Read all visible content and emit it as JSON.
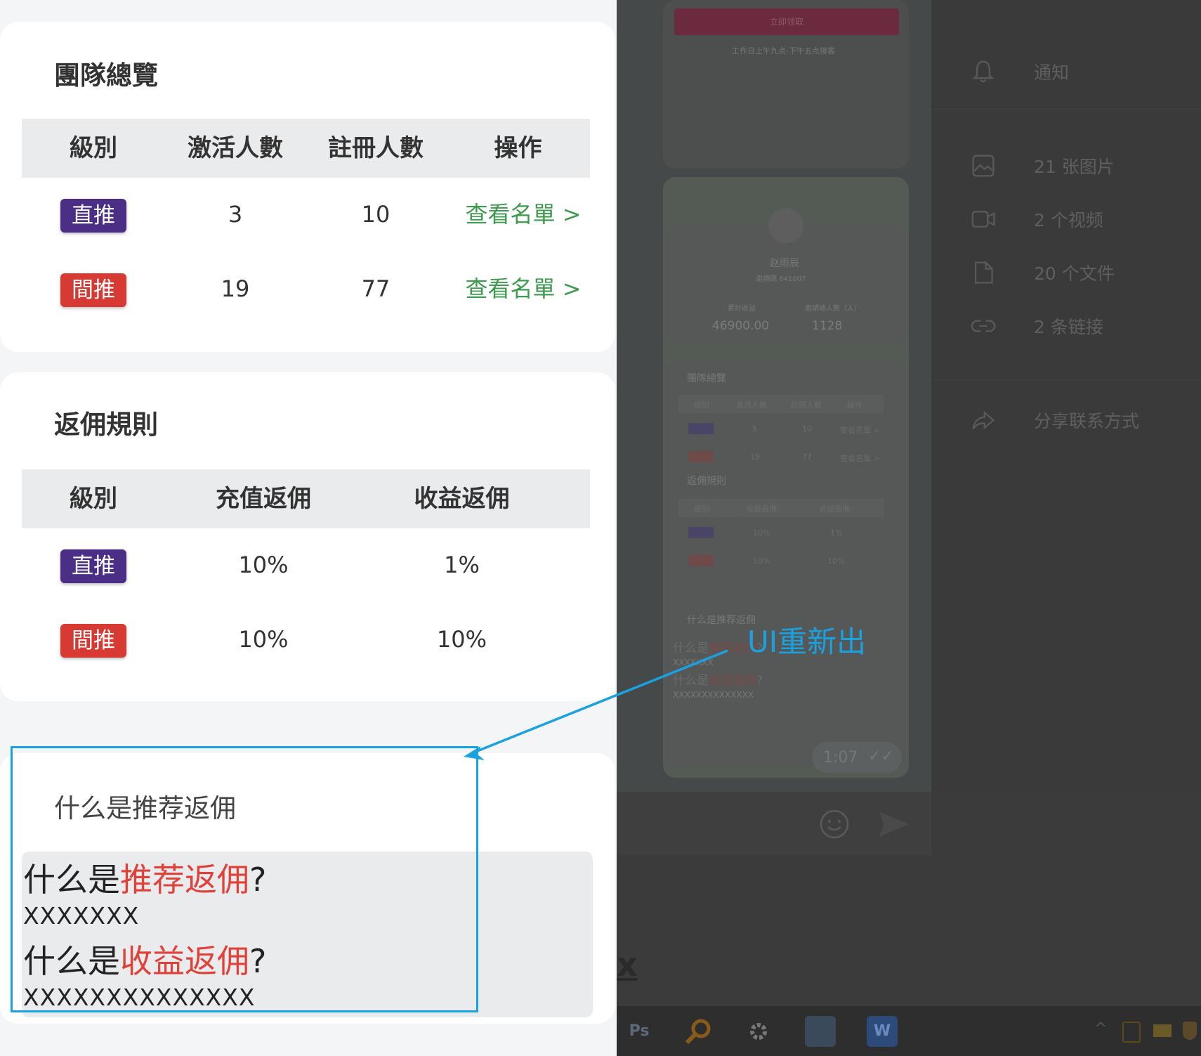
{
  "team_overview": {
    "title": "團隊總覽",
    "headers": [
      "級別",
      "激活人數",
      "註冊人數",
      "操作"
    ],
    "rows": [
      {
        "level": "直推",
        "active": "3",
        "registered": "10",
        "action": "查看名單 >"
      },
      {
        "level": "間推",
        "active": "19",
        "registered": "77",
        "action": "查看名單 >"
      }
    ]
  },
  "commission_rules": {
    "title": "返佣規則",
    "headers": [
      "級別",
      "充值返佣",
      "收益返佣"
    ],
    "rows": [
      {
        "level": "直推",
        "recharge": "10%",
        "earnings": "1%"
      },
      {
        "level": "間推",
        "recharge": "10%",
        "earnings": "10%"
      }
    ]
  },
  "faq": {
    "title": "什么是推荐返佣",
    "q1_prefix": "什么是",
    "q1_highlight": "推荐返佣",
    "q1_suffix": "?",
    "a1": "XXXXXXX",
    "q2_prefix": "什么是",
    "q2_highlight": "收益返佣",
    "q2_suffix": "?",
    "a2": "XXXXXXXXXXXXXX"
  },
  "annotation": {
    "text": "UI重新出",
    "color": "#1aa1e0"
  },
  "chat_preview": {
    "button_label": "立即领取",
    "hours_text": "工作日上午九点-下午五点接客",
    "name": "赵雨辰",
    "id_text": "邀請碼 641007",
    "stat_labels": [
      "累計收益",
      "邀請總人數（人）"
    ],
    "balance": "46900.00",
    "count": "1128",
    "team_title": "團隊總覽",
    "team_headers": [
      "級別",
      "激活人數",
      "註冊人數",
      "操作"
    ],
    "team_rows": [
      {
        "active": "3",
        "registered": "10",
        "action": "查看名單 >"
      },
      {
        "active": "19",
        "registered": "77",
        "action": "查看名單 >"
      }
    ],
    "rules_title": "返佣規則",
    "rules_headers": [
      "級別",
      "充值返佣",
      "收益返佣"
    ],
    "rules_rows": [
      {
        "recharge": "10%",
        "earnings": "1%"
      },
      {
        "recharge": "10%",
        "earnings": "10%"
      }
    ],
    "faq_title": "什么是推荐返佣",
    "q1_prefix": "什么是",
    "q1_highlight": "推荐返佣",
    "a1": "XXXXXXX",
    "q2_prefix": "什么是",
    "q2_highlight": "收益返佣",
    "a2": "XXXXXXXXXXXXXX",
    "timestamp": "1:07"
  },
  "side_panel": {
    "items": [
      {
        "icon": "bell-icon",
        "label": "通知"
      },
      {
        "icon": "image-icon",
        "label": "21 张图片"
      },
      {
        "icon": "video-icon",
        "label": "2 个视频"
      },
      {
        "icon": "file-icon",
        "label": "20 个文件"
      },
      {
        "icon": "link-icon",
        "label": "2 条链接"
      },
      {
        "icon": "share-icon",
        "label": "分享联系方式"
      }
    ]
  },
  "taskbar": {
    "icons": [
      "photoshop-icon",
      "search-app-icon",
      "settings-gear-icon",
      "photos-icon",
      "word-icon"
    ],
    "ps_label": "Ps",
    "tray_icons": [
      "chevron-up-icon",
      "clipboard-icon",
      "battery-icon",
      "shield-icon"
    ]
  },
  "colors": {
    "direct_badge": "#4b2f86",
    "indirect_badge": "#d63a33",
    "link_green": "#3d9b4d",
    "highlight_red": "#e0423a"
  }
}
